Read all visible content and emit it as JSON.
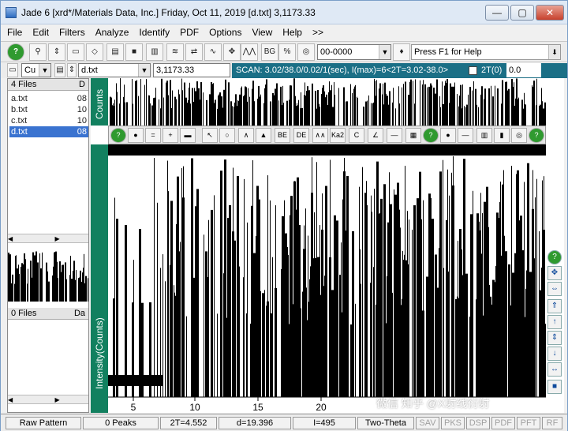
{
  "window": {
    "title": "Jade 6 [xrd*/Materials Data, Inc.] Friday, Oct 11, 2019 [d.txt] 3,1173.33",
    "controls": [
      "—",
      "▢",
      "✕"
    ]
  },
  "menu": [
    "File",
    "Edit",
    "Filters",
    "Analyze",
    "Identify",
    "PDF",
    "Options",
    "View",
    "Help",
    ">>"
  ],
  "toolbar": {
    "pdf_combo_value": "00-0000",
    "help_text": "Press F1 for Help"
  },
  "row2": {
    "target_value": "Cu",
    "file_value": "d.txt",
    "coord_value": "3,1173.33",
    "scan_text": "SCAN: 3.02/38.0/0.02/1(sec), I(max)=6<2T=3.02-38.0>",
    "twotheta_label": "2T(0)",
    "twotheta_value": "0.0"
  },
  "left_panel": {
    "files_header": "4 Files",
    "date_header": "D",
    "files": [
      {
        "name": "a.txt",
        "date": "08"
      },
      {
        "name": "b.txt",
        "date": "10"
      },
      {
        "name": "c.txt",
        "date": "10"
      },
      {
        "name": "d.txt",
        "date": "08"
      }
    ],
    "zero_files_header": "0 Files",
    "zero_date_header": "Da"
  },
  "plot": {
    "counts_label": "Counts",
    "intensity_label": "Intensity(Counts)",
    "x_ticks": [
      "5",
      "10",
      "15",
      "20"
    ]
  },
  "status": {
    "mode": "Raw Pattern",
    "peaks": "0 Peaks",
    "twotheta": "2T=4.552",
    "d": "d=19.396",
    "i": "I=495",
    "axis": "Two-Theta",
    "flags": [
      "SAV",
      "PKS",
      "DSP",
      "PDF",
      "PFT",
      "RF"
    ]
  },
  "watermark": "微信 知乎 @X射线衍射",
  "colors": {
    "scan_bar": "#1b6f86",
    "side_strip": "#12805f",
    "selected": "#3a73d0"
  }
}
